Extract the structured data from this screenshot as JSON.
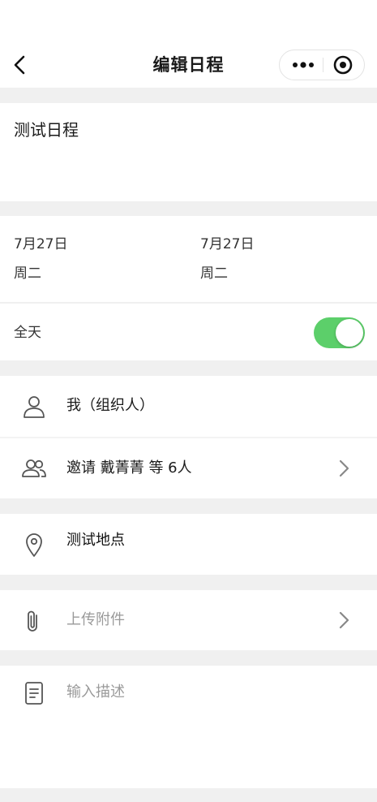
{
  "navbar": {
    "title": "编辑日程",
    "back_icon": "chevron-left-icon",
    "more_icon": "more-dots-icon",
    "close_icon": "target-circle-icon"
  },
  "event": {
    "title": "测试日程"
  },
  "time": {
    "start_date": "7月27日",
    "start_weekday": "周二",
    "end_date": "7月27日",
    "end_weekday": "周二"
  },
  "allday": {
    "label": "全天",
    "enabled": true,
    "accent_color": "#5ccf6a"
  },
  "organizer": {
    "label": "我（组织人）",
    "icon": "person-icon"
  },
  "invitees": {
    "label": "邀请 戴菁菁 等 6人",
    "icon": "people-icon"
  },
  "location": {
    "label": "测试地点",
    "icon": "location-pin-icon"
  },
  "attachment": {
    "placeholder": "上传附件",
    "icon": "paperclip-icon"
  },
  "description": {
    "placeholder": "输入描述",
    "icon": "document-icon"
  }
}
